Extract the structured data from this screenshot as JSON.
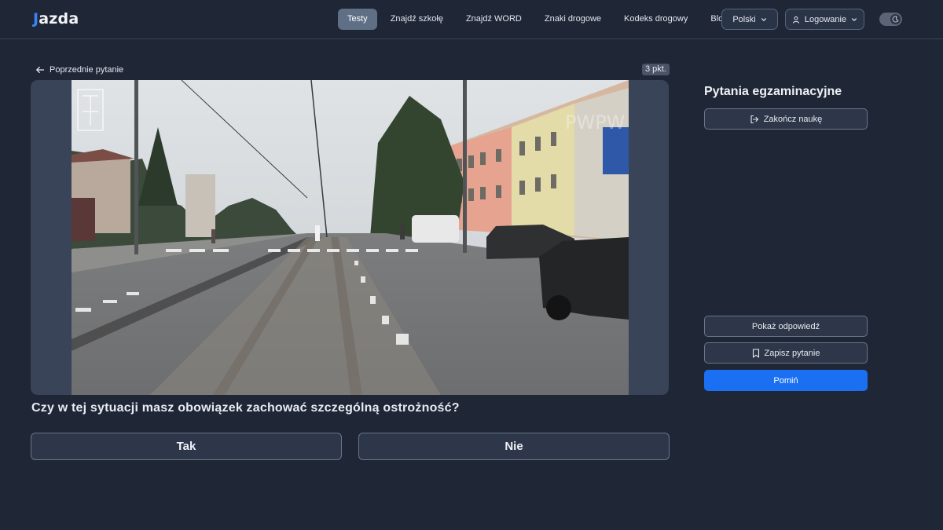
{
  "header": {
    "logo_text": "azda",
    "logo_mark": "J",
    "nav": [
      {
        "label": "Testy",
        "active": true
      },
      {
        "label": "Znajdź szkołę",
        "active": false
      },
      {
        "label": "Znajdź WORD",
        "active": false
      },
      {
        "label": "Znaki drogowe",
        "active": false
      },
      {
        "label": "Kodeks drogowy",
        "active": false
      },
      {
        "label": "Blog",
        "active": false
      }
    ],
    "language_label": "Polski",
    "login_label": "Logowanie",
    "theme_toggle_icon": "moon-icon"
  },
  "question_panel": {
    "prev_label": "Poprzednie pytanie",
    "points": "3 pkt.",
    "question_text": "Czy w tej sytuacji masz obowiązek zachować szczególną ostrożność?",
    "answers": [
      "Tak",
      "Nie"
    ],
    "media_watermarks": [
      "PWPW"
    ]
  },
  "sidebar": {
    "title": "Pytania egzaminacyjne",
    "end_label": "Zakończ naukę",
    "show_answer_label": "Pokaż odpowiedź",
    "save_label": "Zapisz pytanie",
    "skip_label": "Pomiń"
  },
  "colors": {
    "background": "#1f2737",
    "accent": "#1a6ff3",
    "active_nav": "#5f6f85"
  }
}
